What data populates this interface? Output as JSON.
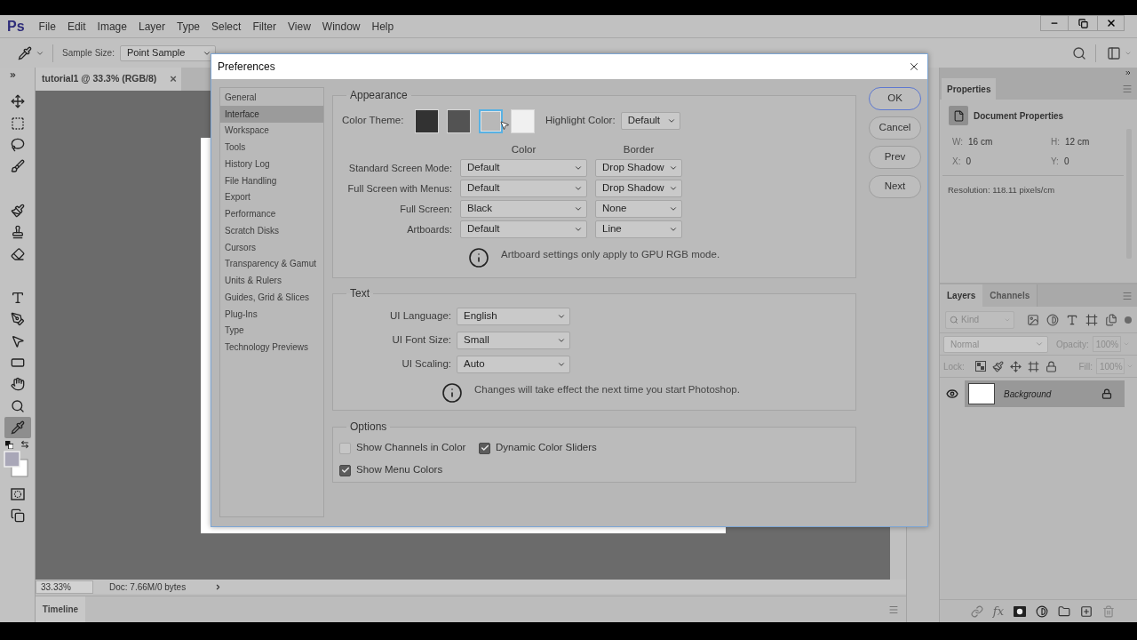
{
  "app": {
    "logo": "Ps"
  },
  "menu": [
    "File",
    "Edit",
    "Image",
    "Layer",
    "Type",
    "Select",
    "Filter",
    "View",
    "Window",
    "Help"
  ],
  "options_bar": {
    "sample_size_label": "Sample Size:",
    "sample_size": "Point Sample"
  },
  "tools": [
    [
      {
        "kind": "move",
        "selected": false
      },
      {
        "kind": "marquee",
        "selected": false
      },
      {
        "kind": "lasso",
        "selected": false
      },
      {
        "kind": "quick_select",
        "selected": false
      }
    ],
    [
      {
        "kind": "brush",
        "selected": false
      },
      {
        "kind": "stamp",
        "selected": false
      },
      {
        "kind": "eraser",
        "selected": false
      }
    ],
    [
      {
        "kind": "type",
        "selected": false
      },
      {
        "kind": "pen",
        "selected": false
      },
      {
        "kind": "path_select",
        "selected": false
      },
      {
        "kind": "shape",
        "selected": false
      },
      {
        "kind": "hand",
        "selected": false
      },
      {
        "kind": "zoom",
        "selected": false
      },
      {
        "kind": "eyedropper",
        "selected": true
      }
    ]
  ],
  "document_tab": {
    "title": "tutorial1 @ 33.3% (RGB/8)",
    "close": "×"
  },
  "status_bar": {
    "zoom": "33.33%",
    "doc_info": "Doc: 7.66M/0 bytes"
  },
  "timeline": {
    "tab": "Timeline"
  },
  "properties": {
    "tab": "Properties",
    "heading": "Document Properties",
    "fields": [
      {
        "label": "W:",
        "value": "16 cm"
      },
      {
        "label": "H:",
        "value": "12 cm"
      },
      {
        "label": "X:",
        "value": "0"
      },
      {
        "label": "Y:",
        "value": "0"
      }
    ],
    "resolution": "Resolution: 118.11 pixels/cm"
  },
  "layers_panel": {
    "tabs": [
      {
        "label": "Layers",
        "selected": true
      },
      {
        "label": "Channels",
        "selected": false
      }
    ],
    "filter_type": "Kind",
    "blend_mode": {
      "value": "Normal",
      "disabled": true
    },
    "opacity": {
      "label": "Opacity:",
      "value": "100%",
      "disabled": true
    },
    "lock_label": "Lock:",
    "fill": {
      "label": "Fill:",
      "value": "100%",
      "disabled": true
    },
    "layers": [
      {
        "name": "Background",
        "visible": true,
        "locked": true,
        "selected": true
      }
    ],
    "footer_fx": "fx"
  },
  "dialog": {
    "title": "Preferences",
    "nav": [
      {
        "label": "General",
        "selected": false
      },
      {
        "label": "Interface",
        "selected": true
      },
      {
        "label": "Workspace",
        "selected": false
      },
      {
        "label": "Tools",
        "selected": false
      },
      {
        "label": "History Log",
        "selected": false
      },
      {
        "label": "File Handling",
        "selected": false
      },
      {
        "label": "Export",
        "selected": false
      },
      {
        "label": "Performance",
        "selected": false
      },
      {
        "label": "Scratch Disks",
        "selected": false
      },
      {
        "label": "Cursors",
        "selected": false
      },
      {
        "label": "Transparency & Gamut",
        "selected": false
      },
      {
        "label": "Units & Rulers",
        "selected": false
      },
      {
        "label": "Guides, Grid & Slices",
        "selected": false
      },
      {
        "label": "Plug-Ins",
        "selected": false
      },
      {
        "label": "Type",
        "selected": false
      },
      {
        "label": "Technology Previews",
        "selected": false
      }
    ],
    "appearance": {
      "legend": "Appearance",
      "theme_label": "Color Theme:",
      "themes": [
        {
          "color": "#323232",
          "selected": false
        },
        {
          "color": "#535353",
          "selected": false
        },
        {
          "color": "#b8b8b8",
          "selected": true
        },
        {
          "color": "#f0f0f0",
          "selected": false
        }
      ],
      "highlight_label": "Highlight Color:",
      "highlight": "Default",
      "headers": [
        "Color",
        "Border"
      ],
      "rows": [
        {
          "label": "Standard Screen Mode:",
          "color_setting": "Default",
          "border_setting": "Drop Shadow"
        },
        {
          "label": "Full Screen with Menus:",
          "color_setting": "Default",
          "border_setting": "Drop Shadow"
        },
        {
          "label": "Full Screen:",
          "color_setting": "Black",
          "border_setting": "None"
        },
        {
          "label": "Artboards:",
          "color_setting": "Default",
          "border_setting": "Line"
        }
      ],
      "note": "Artboard settings only apply to GPU RGB mode."
    },
    "text": {
      "legend": "Text",
      "rows": [
        {
          "label": "UI Language:",
          "value": "English"
        },
        {
          "label": "UI Font Size:",
          "value": "Small"
        },
        {
          "label": "UI Scaling:",
          "value": "Auto"
        }
      ],
      "note": "Changes will take effect the next time you start Photoshop."
    },
    "options": {
      "legend": "Options",
      "checkboxes": [
        {
          "label": "Show Channels in Color",
          "checked": false
        },
        {
          "label": "Dynamic Color Sliders",
          "checked": true
        },
        {
          "label": "Show Menu Colors",
          "checked": true
        }
      ]
    },
    "buttons": [
      {
        "label": "OK",
        "default": true
      },
      {
        "label": "Cancel",
        "default": false
      },
      {
        "label": "Prev",
        "default": false
      },
      {
        "label": "Next",
        "default": false
      }
    ]
  }
}
